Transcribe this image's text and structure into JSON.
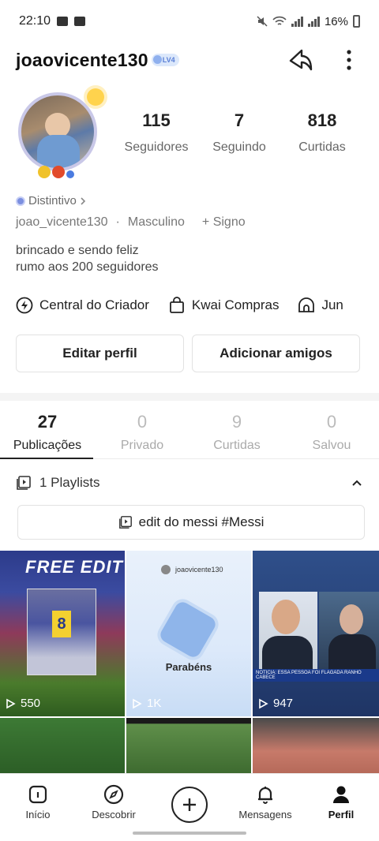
{
  "status_bar": {
    "time": "22:10",
    "battery": "16%"
  },
  "header": {
    "username": "joaovicente130",
    "level": "LV4"
  },
  "stats": [
    {
      "value": "115",
      "label": "Seguidores"
    },
    {
      "value": "7",
      "label": "Seguindo"
    },
    {
      "value": "818",
      "label": "Curtidas"
    }
  ],
  "profile": {
    "badge_label": "Distintivo",
    "handle": "joao_vicente130",
    "separator": "·",
    "gender": "Masculino",
    "sign": "+ Signo",
    "bio_line1": "brincado e sendo feliz",
    "bio_line2": "rumo aos 200 seguidores"
  },
  "creator_links": [
    {
      "label": "Central do Criador",
      "icon": "lightning-icon"
    },
    {
      "label": "Kwai Compras",
      "icon": "shopping-bag-icon"
    },
    {
      "label": "Jun",
      "icon": "arch-icon"
    }
  ],
  "actions": {
    "edit": "Editar perfil",
    "add_friends": "Adicionar amigos"
  },
  "tabs": [
    {
      "count": "27",
      "label": "Publicações",
      "active": true
    },
    {
      "count": "0",
      "label": "Privado"
    },
    {
      "count": "9",
      "label": "Curtidas"
    },
    {
      "count": "0",
      "label": "Salvou"
    }
  ],
  "playlists": {
    "header": "1 Playlists",
    "item": "edit do messi #Messi"
  },
  "grid": [
    {
      "overlay": "FREE EDIT",
      "views": "550"
    },
    {
      "user": "joaovicente130",
      "title": "Parabéns",
      "views": "1K"
    },
    {
      "banner": "NOTICIA: ESSA PESSOA FOI FLAGADA RANHO CABECE",
      "views": "947"
    }
  ],
  "nav": [
    {
      "label": "Início",
      "icon": "home-icon"
    },
    {
      "label": "Descobrir",
      "icon": "compass-icon"
    },
    {
      "label": "",
      "icon": "plus-icon"
    },
    {
      "label": "Mensagens",
      "icon": "bell-icon"
    },
    {
      "label": "Perfil",
      "icon": "person-icon",
      "active": true
    }
  ]
}
